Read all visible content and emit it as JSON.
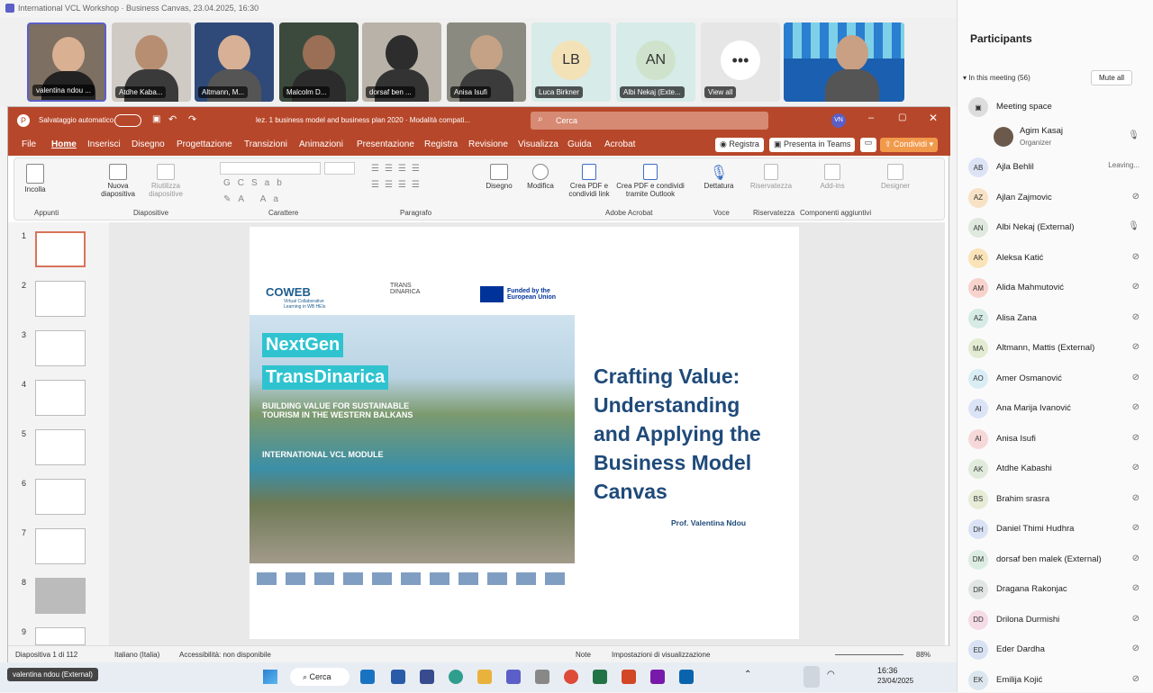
{
  "window": {
    "title": "International VCL Workshop · Business Canvas, 23.04.2025, 16:30"
  },
  "videos": [
    {
      "name": "valentina ndou ..."
    },
    {
      "name": "Atdhe Kaba..."
    },
    {
      "name": "Altmann, M..."
    },
    {
      "name": "Malcolm D..."
    },
    {
      "name": "dorsaf ben ..."
    },
    {
      "name": "Anisa Isufi"
    },
    {
      "name": "Luca Birkner",
      "initials": "LB"
    },
    {
      "name": "Albi Nekaj (Exte...",
      "initials": "AN"
    },
    {
      "name": "View all"
    }
  ],
  "ppt": {
    "autosave": "Salvataggio automatico",
    "doc_title": "lez. 1 business model and business plan 2020 · Modalità compati...",
    "search": "Cerca",
    "user": "VN",
    "tabs": [
      "File",
      "Home",
      "Inserisci",
      "Disegno",
      "Progettazione",
      "Transizioni",
      "Animazioni",
      "Presentazione",
      "Registra",
      "Revisione",
      "Visualizza",
      "Guida",
      "Acrobat"
    ],
    "registra_btn": "Registra",
    "teams_btn": "Presenta in Teams",
    "share_btn": "Condividi",
    "groups": {
      "appunti": "Appunti",
      "diapositive": "Diapositive",
      "carattere": "Carattere",
      "paragrafo": "Paragrafo",
      "acrobat": "Adobe Acrobat",
      "voce": "Voce",
      "riservatezza": "Riservatezza",
      "componenti": "Componenti aggiuntivi"
    },
    "buttons": {
      "incolla": "Incolla",
      "nuova": "Nuova diapositiva",
      "riutilizza": "Riutilizza diapositive",
      "disegno": "Disegno",
      "modifica": "Modifica",
      "pdf1": "Crea PDF e condividi link",
      "pdf2": "Crea PDF e condividi tramite Outlook",
      "dettatura": "Dettatura",
      "riserv": "Riservatezza",
      "addins": "Add-ins",
      "designer": "Designer"
    },
    "thumb_numbers": [
      "1",
      "2",
      "3",
      "4",
      "5",
      "6",
      "7",
      "8",
      "9"
    ],
    "slide": {
      "coweb": "COWEB",
      "coweb_sub": "Virtual Collaborative Learning in WB HEIs",
      "transdinarica": "TRANS DINARICA",
      "eu": "Funded by the European Union",
      "nextgen": "NextGen",
      "transd": "TransDinarica",
      "building": "BUILDING VALUE FOR SUSTAINABLE TOURISM IN THE WESTERN BALKANS",
      "vcl": "INTERNATIONAL VCL MODULE",
      "title": "Crafting Value: Understanding and Applying the Business Model Canvas",
      "author": "Prof. Valentina Ndou"
    },
    "status": {
      "slide": "Diapositiva 1 di 112",
      "lang": "Italiano (Italia)",
      "access": "Accessibilità: non disponibile",
      "note": "Note",
      "view": "Impostazioni di visualizzazione",
      "zoom": "88%"
    }
  },
  "taskbar": {
    "search": "Cerca",
    "time": "16:36",
    "date": "23/04/2025",
    "tooltip": "valentina ndou (External)"
  },
  "sidebar": {
    "title": "Participants",
    "meeting": "In this meeting (56)",
    "mute_all": "Mute all",
    "space": "Meeting space",
    "organizer_name": "Agim Kasaj",
    "organizer_role": "Organizer",
    "people": [
      {
        "i": "AB",
        "n": "Ajla Behlil",
        "s": "Leaving...",
        "c": "#dce3f5"
      },
      {
        "i": "AZ",
        "n": "Ajlan Zajmovic",
        "c": "#f7e2c6"
      },
      {
        "i": "AN",
        "n": "Albi Nekaj (External)",
        "c": "#dfe9df"
      },
      {
        "i": "AK",
        "n": "Aleksa Katić",
        "c": "#fbe3b8"
      },
      {
        "i": "AM",
        "n": "Alida Mahmutović",
        "c": "#f7d3cc"
      },
      {
        "i": "AZ",
        "n": "Alisa Zana",
        "c": "#d6ebe5"
      },
      {
        "i": "MA",
        "n": "Altmann, Mattis (External)",
        "c": "#e3ecd2"
      },
      {
        "i": "AO",
        "n": "Amer Osmanović",
        "c": "#d9edf5"
      },
      {
        "i": "AI",
        "n": "Ana Marija Ivanović",
        "c": "#dbe3f6"
      },
      {
        "i": "AI",
        "n": "Anisa Isufi",
        "c": "#f6d8d8"
      },
      {
        "i": "AK",
        "n": "Atdhe Kabashi",
        "c": "#e1ebdc"
      },
      {
        "i": "BS",
        "n": "Brahim srasra",
        "c": "#e7ecd7"
      },
      {
        "i": "DH",
        "n": "Daniel Thimi Hudhra",
        "c": "#dae3f6"
      },
      {
        "i": "DM",
        "n": "dorsaf ben malek (External)",
        "c": "#dbece3"
      },
      {
        "i": "DR",
        "n": "Dragana Rakonjac",
        "c": "#e1e5e3"
      },
      {
        "i": "DD",
        "n": "Drilona Durmishi",
        "c": "#f5dbe5"
      },
      {
        "i": "ED",
        "n": "Eder Dardha",
        "c": "#d8e2f4"
      },
      {
        "i": "EK",
        "n": "Emilija Kojić",
        "c": "#dbe6ee"
      }
    ]
  }
}
